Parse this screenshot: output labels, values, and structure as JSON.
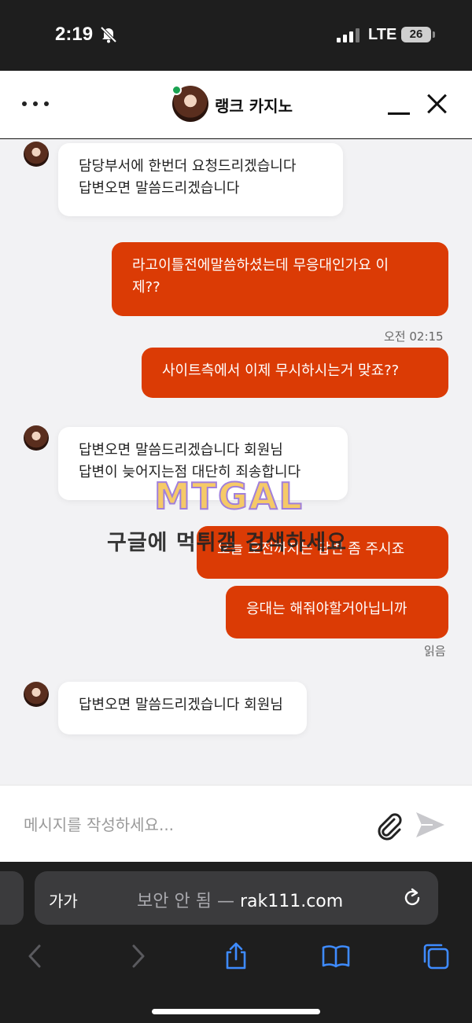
{
  "status_bar": {
    "time": "2:19",
    "network": "LTE",
    "battery": "26"
  },
  "header": {
    "title": "랭크 카지노"
  },
  "messages": [
    {
      "direction": "in",
      "text": "담당부서에 한번더 요청드리겠습니다\n답변오면 말씀드리겠습니다"
    },
    {
      "direction": "out",
      "text": "라고이틀전에말씀하셨는데 무응대인가요 이\n제??"
    },
    {
      "direction": "out",
      "text": "사이트측에서 이제 무시하시는거 맞죠??",
      "time": "오전 02:15"
    },
    {
      "direction": "in",
      "text": "답변오면 말씀드리겠습니다 회원님\n답변이 늦어지는점 대단히 죄송합니다"
    },
    {
      "direction": "out",
      "text": "오늘 오전까지는 답변 좀 주시죠"
    },
    {
      "direction": "out",
      "text": "응대는 해줘야할거아닙니까",
      "status": "읽음"
    },
    {
      "direction": "in",
      "text": "답변오면 말씀드리겠습니다 회원님"
    }
  ],
  "watermark": {
    "logo": "MTGAL",
    "text": "구글에 먹튀갤 검색하세요"
  },
  "compose": {
    "placeholder": "메시지를 작성하세요..."
  },
  "safari": {
    "aa_label": "가가",
    "security": "보안 안 됨",
    "separator": "—",
    "domain": "rak111.com"
  },
  "colors": {
    "accent": "#db3b05",
    "online": "#1aa251",
    "safari_blue": "#3e8bff"
  },
  "icons": [
    "bell-slash-icon",
    "signal-icon",
    "battery-icon",
    "menu-dots-icon",
    "minimize-icon",
    "close-icon",
    "paperclip-icon",
    "send-icon",
    "reload-icon",
    "back-icon",
    "forward-icon",
    "share-icon",
    "bookmarks-icon",
    "tabs-icon"
  ]
}
